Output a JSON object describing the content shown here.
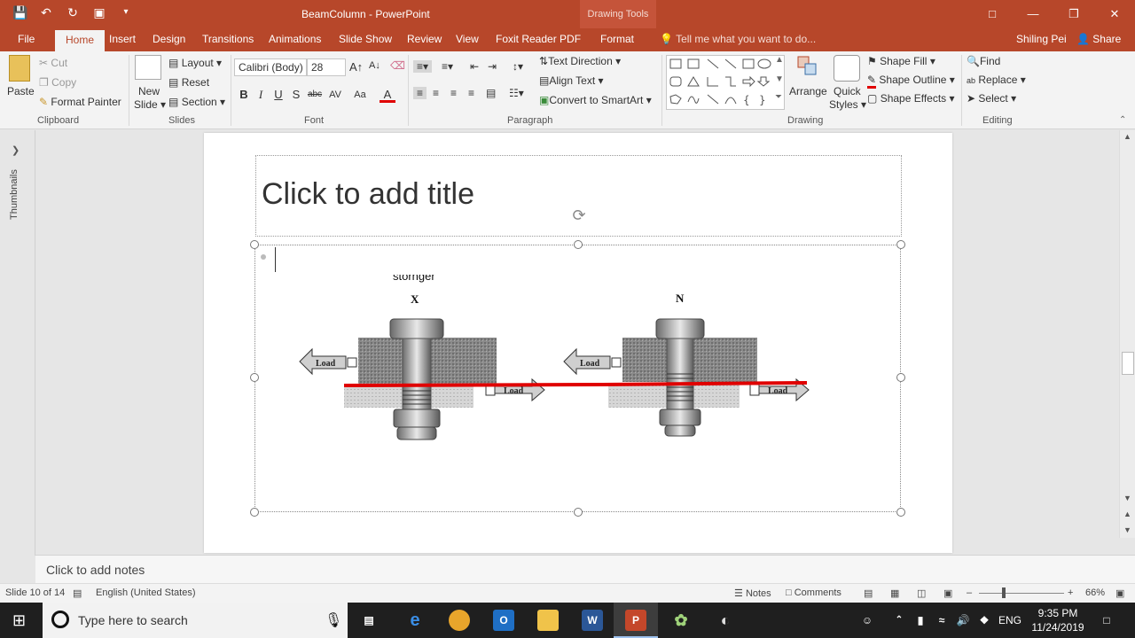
{
  "window": {
    "title": "BeamColumn - PowerPoint",
    "context_tab_header": "Drawing Tools",
    "user": "Shiling Pei",
    "share_label": "Share"
  },
  "tabs": [
    {
      "label": "File"
    },
    {
      "label": "Home",
      "active": true
    },
    {
      "label": "Insert"
    },
    {
      "label": "Design"
    },
    {
      "label": "Transitions"
    },
    {
      "label": "Animations"
    },
    {
      "label": "Slide Show"
    },
    {
      "label": "Review"
    },
    {
      "label": "View"
    },
    {
      "label": "Foxit Reader PDF"
    },
    {
      "label": "Format"
    }
  ],
  "tell_me": "Tell me what you want to do...",
  "ribbon": {
    "clipboard": {
      "label": "Clipboard",
      "paste": "Paste",
      "cut": "Cut",
      "copy": "Copy",
      "format_painter": "Format Painter"
    },
    "slides": {
      "label": "Slides",
      "new_slide_1": "New",
      "new_slide_2": "Slide",
      "layout": "Layout",
      "reset": "Reset",
      "section": "Section"
    },
    "font": {
      "label": "Font",
      "family": "Calibri (Body)",
      "size": "28"
    },
    "paragraph": {
      "label": "Paragraph",
      "text_direction": "Text Direction",
      "align_text": "Align Text",
      "convert_smartart": "Convert to SmartArt"
    },
    "drawing": {
      "label": "Drawing",
      "arrange": "Arrange",
      "quick_styles_1": "Quick",
      "quick_styles_2": "Styles",
      "shape_fill": "Shape Fill",
      "shape_outline": "Shape Outline",
      "shape_effects": "Shape Effects"
    },
    "editing": {
      "label": "Editing",
      "find": "Find",
      "replace": "Replace",
      "select": "Select"
    }
  },
  "thumbnails_label": "Thumbnails",
  "slide": {
    "title_placeholder": "Click to add title",
    "figure": {
      "top_label": "stornger",
      "left_letter": "X",
      "right_letter": "N",
      "load_label": "Load"
    }
  },
  "notes_placeholder": "Click to add notes",
  "statusbar": {
    "slide_info": "Slide 10 of 14",
    "language": "English (United States)",
    "notes": "Notes",
    "comments": "Comments",
    "zoom": "66%"
  },
  "taskbar": {
    "search_placeholder": "Type here to search",
    "language": "ENG",
    "time": "9:35 PM",
    "date": "11/24/2019"
  },
  "colors": {
    "accent": "#b7472a",
    "red_line": "#e00000"
  }
}
